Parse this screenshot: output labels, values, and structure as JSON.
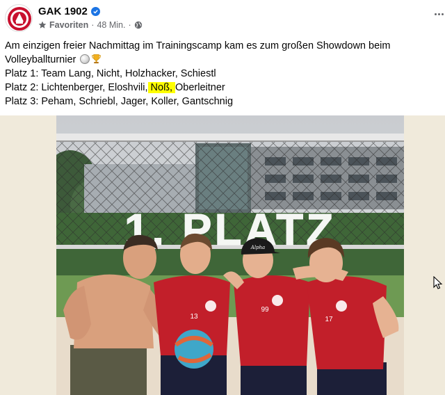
{
  "post": {
    "page_name": "GAK 1902",
    "favorites_label": "Favoriten",
    "separator": "·",
    "time": "48 Min.",
    "text": {
      "line1": "Am einzigen freier Nachmittag im Trainingscamp kam es zum großen Showdown beim",
      "line2": "Volleyballturnier",
      "line3": "Platz 1: Team Lang, Nicht, Holzhacker, Schiestl",
      "line4_before": "Platz 2: Lichtenberger, Eloshvili,",
      "line4_highlight": " Noß, ",
      "line4_after": "Oberleitner",
      "line5": "Platz 3: Peham, Schriebl, Jager, Koller, Gantschnig"
    }
  },
  "photo": {
    "overlay_text": "1. PLATZ",
    "jersey_numbers": [
      "13",
      "99",
      "17"
    ],
    "cap_text": "Alpha"
  },
  "colors": {
    "brand_red": "#c8102e",
    "verified_blue": "#1b74e4",
    "highlight": "#ffff00",
    "meta_gray": "#65676b",
    "media_bg": "#f0eadb"
  },
  "icons": [
    "club-crest-icon",
    "verified-badge-icon",
    "star-icon",
    "globe-icon",
    "more-options-icon",
    "volleyball-emoji-icon",
    "trophy-emoji-icon",
    "mouse-cursor-icon"
  ]
}
